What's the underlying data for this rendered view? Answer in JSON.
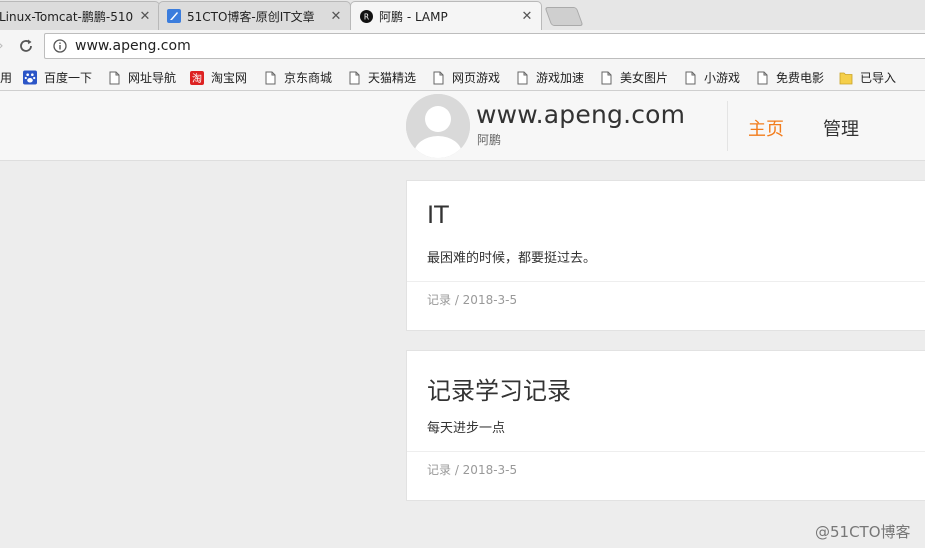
{
  "browser": {
    "tabs": [
      {
        "title": "Linux-Tomcat-鹏鹏-510",
        "close": "✕"
      },
      {
        "title": "51CTO博客-原创IT文章",
        "close": "✕"
      },
      {
        "title": "阿鹏 - LAMP",
        "close": "✕"
      }
    ],
    "address": "www.apeng.com",
    "bookmarks": [
      {
        "label": "用",
        "icon": "apps-icon"
      },
      {
        "label": "百度一下",
        "icon": "baidu-paw-icon"
      },
      {
        "label": "网址导航",
        "icon": "page-icon"
      },
      {
        "label": "淘宝网",
        "icon": "taobao-icon",
        "icon_text": "淘"
      },
      {
        "label": "京东商城",
        "icon": "page-icon"
      },
      {
        "label": "天猫精选",
        "icon": "page-icon"
      },
      {
        "label": "网页游戏",
        "icon": "page-icon"
      },
      {
        "label": "游戏加速",
        "icon": "page-icon"
      },
      {
        "label": "美女图片",
        "icon": "page-icon"
      },
      {
        "label": "小游戏",
        "icon": "page-icon"
      },
      {
        "label": "免费电影",
        "icon": "page-icon"
      },
      {
        "label": "已导入",
        "icon": "folder-icon"
      }
    ]
  },
  "site": {
    "title": "www.apeng.com",
    "subtitle": "阿鹏",
    "nav": {
      "home": "主页",
      "admin": "管理"
    },
    "accent_color": "#f27c1c"
  },
  "posts": [
    {
      "title": "IT",
      "excerpt": "最困难的时候，都要挺过去。",
      "meta": "记录 / 2018-3-5"
    },
    {
      "title": "记录学习记录",
      "excerpt": "每天进步一点",
      "meta": "记录 / 2018-3-5"
    }
  ],
  "watermark": "@51CTO博客"
}
